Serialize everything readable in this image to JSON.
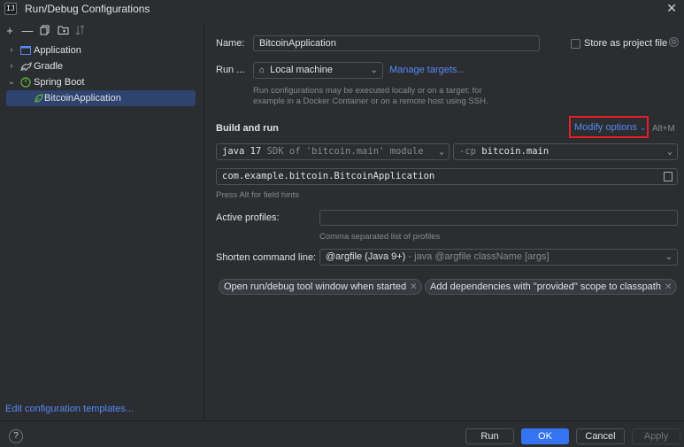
{
  "window": {
    "title": "Run/Debug Configurations",
    "app_icon_text": "IJ"
  },
  "toolbar": {
    "add": "+",
    "remove": "—",
    "copy": "⧉",
    "folder": "🗀",
    "sort": "⇅"
  },
  "tree": {
    "items": [
      {
        "label": "Application"
      },
      {
        "label": "Gradle"
      },
      {
        "label": "Spring Boot"
      },
      {
        "label": "BitcoinApplication"
      }
    ]
  },
  "left_footer": {
    "edit_templates": "Edit configuration templates..."
  },
  "form": {
    "name_label": "Name:",
    "name_value": "BitcoinApplication",
    "store_label": "Store as project file",
    "run_on_label": "Run ...",
    "run_on_value": "Local machine",
    "manage_targets": "Manage targets...",
    "run_on_hint": "Run configurations may be executed locally or on a target: for example in a Docker Container or on a remote host using SSH.",
    "build_run_title": "Build and run",
    "modify_options": "Modify options",
    "modify_shortcut": "Alt+M",
    "jdk_value": "java 17",
    "jdk_suffix": "SDK of 'bitcoin.main' module",
    "cp_prefix": "-cp",
    "cp_value": "bitcoin.main",
    "main_class": "com.example.bitcoin.BitcoinApplication",
    "field_hint": "Press Alt for field hints",
    "profiles_label": "Active profiles:",
    "profiles_value": "",
    "profiles_hint": "Comma separated list of profiles",
    "shorten_label": "Shorten command line:",
    "shorten_value": "@argfile (Java 9+)",
    "shorten_suffix": "- java @argfile className [args]",
    "chips": [
      {
        "label": "Open run/debug tool window when started"
      },
      {
        "label": "Add dependencies with \"provided\" scope to classpath"
      }
    ]
  },
  "footer": {
    "help": "?",
    "run": "Run",
    "ok": "OK",
    "cancel": "Cancel",
    "apply": "Apply"
  },
  "colors": {
    "accent": "#3574f0",
    "link": "#548af7",
    "highlight": "#e5202a",
    "selection": "#2e436e"
  }
}
